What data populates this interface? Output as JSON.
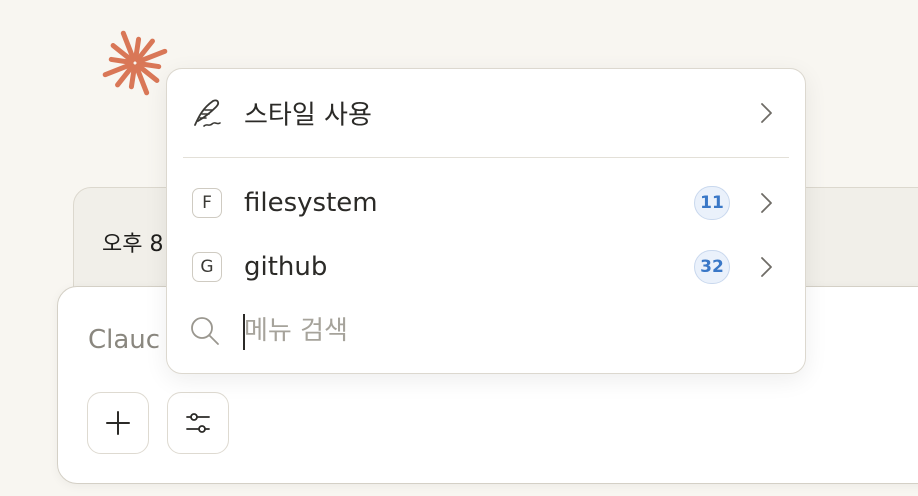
{
  "background": {
    "notice_text": "오후 8",
    "composer_placeholder": "Clauc"
  },
  "toolbar": {
    "add_icon": "plus-icon",
    "options_icon": "sliders-icon"
  },
  "menu": {
    "style_item": {
      "label": "스타일 사용",
      "icon": "quill-icon"
    },
    "connectors": [
      {
        "letter": "F",
        "label": "filesystem",
        "count": "11"
      },
      {
        "letter": "G",
        "label": "github",
        "count": "32"
      }
    ],
    "search": {
      "placeholder": "메뉴 검색",
      "value": ""
    }
  },
  "colors": {
    "logo": "#d97757",
    "badge_text": "#3a78c7",
    "badge_bg": "#eaf1fb"
  }
}
